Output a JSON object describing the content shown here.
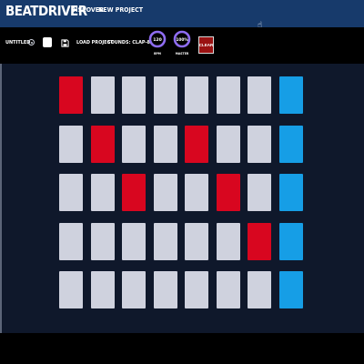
{
  "nav": {
    "brand": "BEATDRIVER",
    "links": [
      "DISCOVER",
      "NEW PROJECT"
    ]
  },
  "toolbar": {
    "title": "UNTITLED",
    "load_label": "LOAD PROJECT",
    "sounds_label": "SOUNDS: CLAP-808",
    "bpm": {
      "value": "120",
      "label": "BPM"
    },
    "master": {
      "value": "100%",
      "label": "MASTER"
    },
    "clear_label": "CLEAR"
  },
  "colors": {
    "nav_bg": "#173a6b",
    "page_bg": "#0f182b",
    "pad_off": "#cfd2de",
    "pad_on": "#d8061f",
    "pad_last_column": "#169ee6",
    "knob_ring": "#8e6cf0",
    "clear_button": "#9a1212"
  },
  "sequencer": {
    "rows": 5,
    "columns": 8,
    "active_steps": [
      [
        1,
        0,
        0,
        0,
        0,
        0,
        0,
        0
      ],
      [
        0,
        1,
        0,
        0,
        1,
        0,
        0,
        0
      ],
      [
        0,
        0,
        1,
        0,
        0,
        1,
        0,
        0
      ],
      [
        0,
        0,
        0,
        0,
        0,
        0,
        1,
        0
      ],
      [
        0,
        0,
        0,
        0,
        0,
        0,
        0,
        0
      ]
    ]
  }
}
